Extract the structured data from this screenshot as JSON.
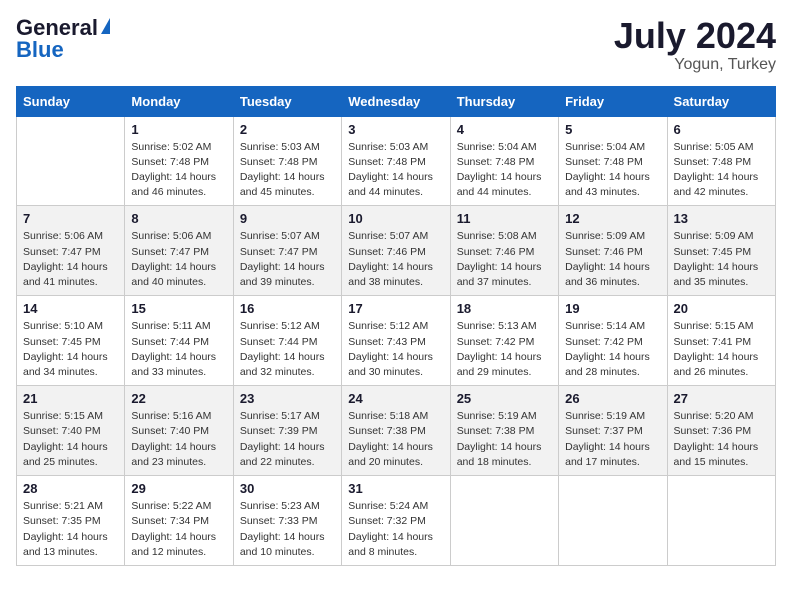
{
  "header": {
    "logo_line1": "General",
    "logo_line2": "Blue",
    "month_year": "July 2024",
    "location": "Yogun, Turkey"
  },
  "days_of_week": [
    "Sunday",
    "Monday",
    "Tuesday",
    "Wednesday",
    "Thursday",
    "Friday",
    "Saturday"
  ],
  "weeks": [
    [
      {
        "day": "",
        "info": ""
      },
      {
        "day": "1",
        "info": "Sunrise: 5:02 AM\nSunset: 7:48 PM\nDaylight: 14 hours\nand 46 minutes."
      },
      {
        "day": "2",
        "info": "Sunrise: 5:03 AM\nSunset: 7:48 PM\nDaylight: 14 hours\nand 45 minutes."
      },
      {
        "day": "3",
        "info": "Sunrise: 5:03 AM\nSunset: 7:48 PM\nDaylight: 14 hours\nand 44 minutes."
      },
      {
        "day": "4",
        "info": "Sunrise: 5:04 AM\nSunset: 7:48 PM\nDaylight: 14 hours\nand 44 minutes."
      },
      {
        "day": "5",
        "info": "Sunrise: 5:04 AM\nSunset: 7:48 PM\nDaylight: 14 hours\nand 43 minutes."
      },
      {
        "day": "6",
        "info": "Sunrise: 5:05 AM\nSunset: 7:48 PM\nDaylight: 14 hours\nand 42 minutes."
      }
    ],
    [
      {
        "day": "7",
        "info": "Sunrise: 5:06 AM\nSunset: 7:47 PM\nDaylight: 14 hours\nand 41 minutes."
      },
      {
        "day": "8",
        "info": "Sunrise: 5:06 AM\nSunset: 7:47 PM\nDaylight: 14 hours\nand 40 minutes."
      },
      {
        "day": "9",
        "info": "Sunrise: 5:07 AM\nSunset: 7:47 PM\nDaylight: 14 hours\nand 39 minutes."
      },
      {
        "day": "10",
        "info": "Sunrise: 5:07 AM\nSunset: 7:46 PM\nDaylight: 14 hours\nand 38 minutes."
      },
      {
        "day": "11",
        "info": "Sunrise: 5:08 AM\nSunset: 7:46 PM\nDaylight: 14 hours\nand 37 minutes."
      },
      {
        "day": "12",
        "info": "Sunrise: 5:09 AM\nSunset: 7:46 PM\nDaylight: 14 hours\nand 36 minutes."
      },
      {
        "day": "13",
        "info": "Sunrise: 5:09 AM\nSunset: 7:45 PM\nDaylight: 14 hours\nand 35 minutes."
      }
    ],
    [
      {
        "day": "14",
        "info": "Sunrise: 5:10 AM\nSunset: 7:45 PM\nDaylight: 14 hours\nand 34 minutes."
      },
      {
        "day": "15",
        "info": "Sunrise: 5:11 AM\nSunset: 7:44 PM\nDaylight: 14 hours\nand 33 minutes."
      },
      {
        "day": "16",
        "info": "Sunrise: 5:12 AM\nSunset: 7:44 PM\nDaylight: 14 hours\nand 32 minutes."
      },
      {
        "day": "17",
        "info": "Sunrise: 5:12 AM\nSunset: 7:43 PM\nDaylight: 14 hours\nand 30 minutes."
      },
      {
        "day": "18",
        "info": "Sunrise: 5:13 AM\nSunset: 7:42 PM\nDaylight: 14 hours\nand 29 minutes."
      },
      {
        "day": "19",
        "info": "Sunrise: 5:14 AM\nSunset: 7:42 PM\nDaylight: 14 hours\nand 28 minutes."
      },
      {
        "day": "20",
        "info": "Sunrise: 5:15 AM\nSunset: 7:41 PM\nDaylight: 14 hours\nand 26 minutes."
      }
    ],
    [
      {
        "day": "21",
        "info": "Sunrise: 5:15 AM\nSunset: 7:40 PM\nDaylight: 14 hours\nand 25 minutes."
      },
      {
        "day": "22",
        "info": "Sunrise: 5:16 AM\nSunset: 7:40 PM\nDaylight: 14 hours\nand 23 minutes."
      },
      {
        "day": "23",
        "info": "Sunrise: 5:17 AM\nSunset: 7:39 PM\nDaylight: 14 hours\nand 22 minutes."
      },
      {
        "day": "24",
        "info": "Sunrise: 5:18 AM\nSunset: 7:38 PM\nDaylight: 14 hours\nand 20 minutes."
      },
      {
        "day": "25",
        "info": "Sunrise: 5:19 AM\nSunset: 7:38 PM\nDaylight: 14 hours\nand 18 minutes."
      },
      {
        "day": "26",
        "info": "Sunrise: 5:19 AM\nSunset: 7:37 PM\nDaylight: 14 hours\nand 17 minutes."
      },
      {
        "day": "27",
        "info": "Sunrise: 5:20 AM\nSunset: 7:36 PM\nDaylight: 14 hours\nand 15 minutes."
      }
    ],
    [
      {
        "day": "28",
        "info": "Sunrise: 5:21 AM\nSunset: 7:35 PM\nDaylight: 14 hours\nand 13 minutes."
      },
      {
        "day": "29",
        "info": "Sunrise: 5:22 AM\nSunset: 7:34 PM\nDaylight: 14 hours\nand 12 minutes."
      },
      {
        "day": "30",
        "info": "Sunrise: 5:23 AM\nSunset: 7:33 PM\nDaylight: 14 hours\nand 10 minutes."
      },
      {
        "day": "31",
        "info": "Sunrise: 5:24 AM\nSunset: 7:32 PM\nDaylight: 14 hours\nand 8 minutes."
      },
      {
        "day": "",
        "info": ""
      },
      {
        "day": "",
        "info": ""
      },
      {
        "day": "",
        "info": ""
      }
    ]
  ]
}
